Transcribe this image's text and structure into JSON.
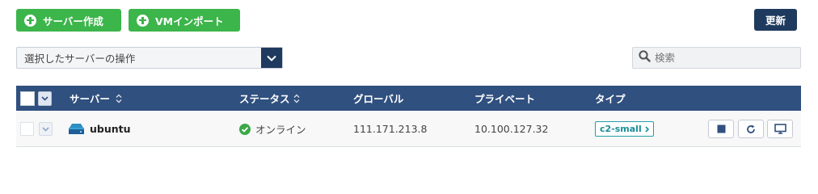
{
  "toolbar": {
    "create_label": "サーバー作成",
    "import_label": "VMインポート",
    "refresh_label": "更新"
  },
  "action_select": {
    "selected": "選択したサーバーの操作"
  },
  "search": {
    "placeholder": "検索"
  },
  "table": {
    "headers": {
      "server": "サーバー",
      "status": "ステータス",
      "global": "グローバル",
      "private": "プライベート",
      "type": "タイプ"
    },
    "rows": [
      {
        "name": "ubuntu",
        "status": "オンライン",
        "global_ip": "111.171.213.8",
        "private_ip": "10.100.127.32",
        "type": "c2-small"
      }
    ]
  },
  "colors": {
    "green": "#3cb54a",
    "navy": "#1f3a5f",
    "header": "#30507f",
    "teal": "#1fa0a8",
    "online": "#3aa847"
  }
}
